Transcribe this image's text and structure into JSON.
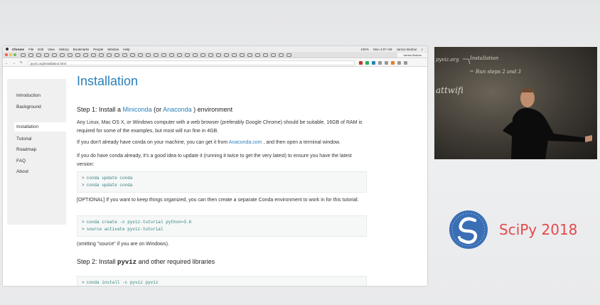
{
  "menubar": {
    "app": "Chrome",
    "items": [
      "File",
      "Edit",
      "View",
      "History",
      "Bookmarks",
      "People",
      "Window",
      "Help"
    ],
    "battery": "100%",
    "time": "Mon 4:07 AM",
    "user": "James Bednar"
  },
  "address_bar": {
    "url": "pyviz.org/installation.html"
  },
  "sidebar": {
    "items": [
      "Introduction",
      "Background",
      "Installation",
      "Tutorial",
      "Roadmap",
      "FAQ",
      "About"
    ],
    "active": "Installation"
  },
  "content": {
    "title": "Installation",
    "step1": {
      "prefix": "Step 1: Install a ",
      "link1": "Miniconda",
      "mid": " (or ",
      "link2": "Anaconda",
      "suffix": " ) environment"
    },
    "para1": "Any Linux, Mac OS X, or Windows computer with a web browser (preferably Google Chrome) should be suitable. 16GB of RAM is required for some of the examples, but most will run fine in 4GB.",
    "para2": {
      "prefix": "If you don't already have conda on your machine, you can get it from ",
      "link": "Anaconda.com",
      "suffix": " , and then open a terminal window."
    },
    "para3": "If you do have conda already, it's a good idea to update it (running it twice to get the very latest) to ensure you have the latest version:",
    "code1": [
      "conda update conda",
      "conda update conda"
    ],
    "para4": "[OPTIONAL] If you want to keep things organized, you can then create a separate Conda environment to work in for this tutorial:",
    "code2": [
      "conda create -n pyviz-tutorial python=3.6",
      "source activate pyviz-tutorial"
    ],
    "para5": "(omitting \"source\" if you are on Windows).",
    "step2": {
      "prefix": "Step 2: Install ",
      "code": "pyviz",
      "suffix": " and other required libraries"
    },
    "code3": [
      "conda install -c pyviz pyviz"
    ]
  },
  "chalkboard": {
    "line1": "pyviz.org",
    "line2": "Installation",
    "line3": "Run steps 2 and 3",
    "line4": "attwifi"
  },
  "logo": {
    "text": "SciPy 2018"
  },
  "colors": {
    "link": "#2980b9",
    "code_text": "#2f7f7f",
    "logo_red": "#e34a4a",
    "logo_blue": "#3a6fb5"
  }
}
